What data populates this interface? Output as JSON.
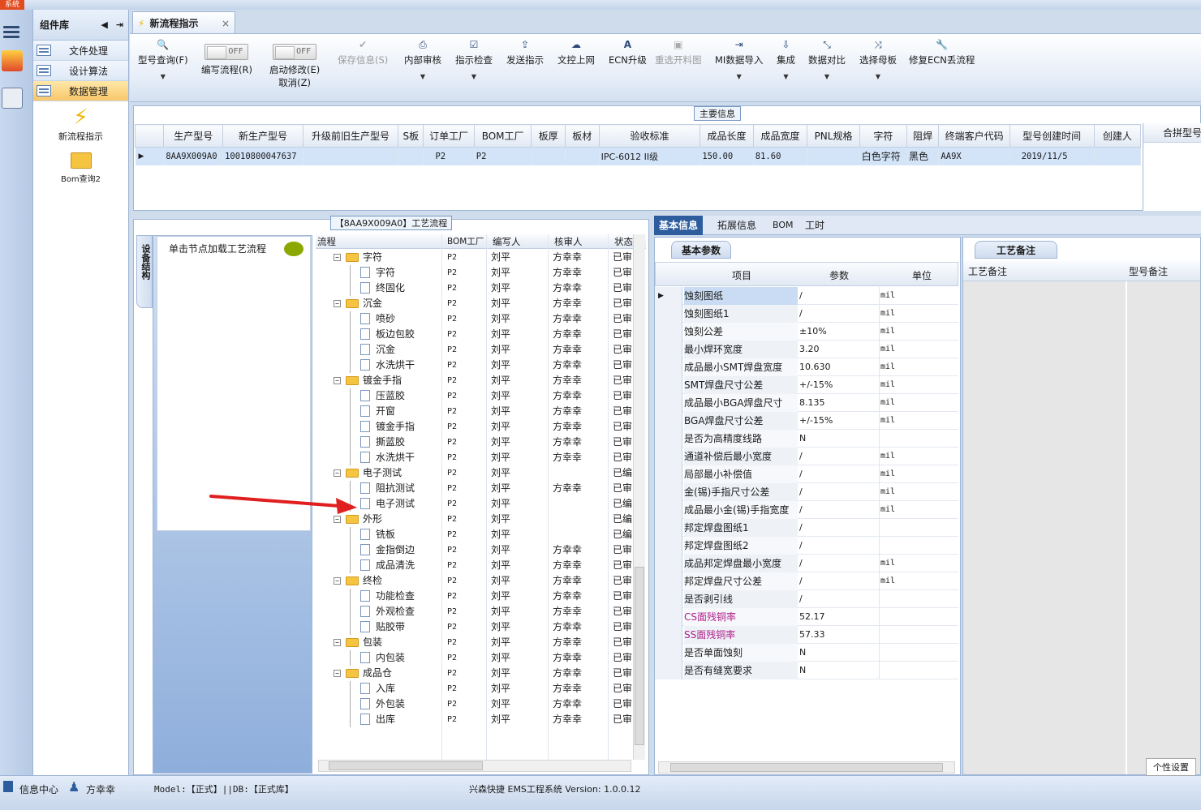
{
  "window": {
    "title": "系统"
  },
  "left_panel": {
    "title": "组件库",
    "items": [
      {
        "label": "文件处理"
      },
      {
        "label": "设计算法"
      },
      {
        "label": "数据管理"
      }
    ],
    "big_items": [
      {
        "label": "新流程指示",
        "icon": "lightning-icon"
      },
      {
        "label": "Bom查询2",
        "icon": "folder-open-icon"
      }
    ]
  },
  "doc_tab": {
    "title": "新流程指示"
  },
  "toolbar": {
    "items": [
      {
        "label": "型号查询(F)",
        "icon": "search-icon"
      },
      {
        "label": "编写流程(R)",
        "toggle": "OFF"
      },
      {
        "label": "启动修改(E)",
        "sub": "取消(Z)",
        "toggle": "OFF"
      },
      {
        "label": "保存信息(S)",
        "icon": "check-icon",
        "disabled": true
      },
      {
        "label": "内部审核",
        "icon": "printer-icon"
      },
      {
        "label": "指示检查",
        "icon": "checkbox-icon"
      },
      {
        "label": "发送指示",
        "icon": "upload-icon"
      },
      {
        "label": "文控上网",
        "icon": "cloud-upload-icon"
      },
      {
        "label": "ECN升级",
        "icon": "font-icon"
      },
      {
        "label": "重选开料图",
        "icon": "image-icon",
        "disabled": true
      },
      {
        "label": "MI数据导入",
        "icon": "import-icon"
      },
      {
        "label": "集成",
        "icon": "download-icon"
      },
      {
        "label": "数据对比",
        "icon": "compress-icon"
      },
      {
        "label": "选择母板",
        "icon": "shuffle-icon"
      },
      {
        "label": "修复ECN丢流程",
        "icon": "wrench-icon"
      }
    ]
  },
  "main_info": {
    "title": "主要信息",
    "columns": [
      "生产型号",
      "新生产型号",
      "升级前旧生产型号",
      "S板",
      "订单工厂",
      "BOM工厂",
      "板厚",
      "板材",
      "验收标准",
      "成品长度",
      "成品宽度",
      "PNL规格",
      "字符",
      "阻焊",
      "终端客户代码",
      "型号创建时间",
      "创建人"
    ],
    "rows": [
      [
        "8AA9X009A0",
        "10010800047637",
        "",
        "",
        "P2",
        "P2",
        "",
        "",
        "IPC-6012 II级",
        "150.00",
        "81.60",
        "",
        "白色字符",
        "黑色",
        "AA9X",
        "2019/11/5",
        ""
      ]
    ],
    "right_header": "合拼型号"
  },
  "flow_panel": {
    "title": "【8AA9X009A0】工艺流程",
    "side_tab": "设备结构",
    "hint": "单击节点加载工艺流程",
    "columns": [
      "流程",
      "BOM工厂",
      "编写人",
      "核审人",
      "状态"
    ],
    "rows": [
      {
        "level": 0,
        "name": "字符",
        "bom": "P2",
        "writer": "刘平",
        "reviewer": "方幸幸",
        "status": "已审"
      },
      {
        "level": 1,
        "name": "字符",
        "bom": "P2",
        "writer": "刘平",
        "reviewer": "方幸幸",
        "status": "已审"
      },
      {
        "level": 1,
        "name": "终固化",
        "bom": "P2",
        "writer": "刘平",
        "reviewer": "方幸幸",
        "status": "已审"
      },
      {
        "level": 0,
        "name": "沉金",
        "bom": "P2",
        "writer": "刘平",
        "reviewer": "方幸幸",
        "status": "已审"
      },
      {
        "level": 1,
        "name": "喷砂",
        "bom": "P2",
        "writer": "刘平",
        "reviewer": "方幸幸",
        "status": "已审"
      },
      {
        "level": 1,
        "name": "板边包胶",
        "bom": "P2",
        "writer": "刘平",
        "reviewer": "方幸幸",
        "status": "已审"
      },
      {
        "level": 1,
        "name": "沉金",
        "bom": "P2",
        "writer": "刘平",
        "reviewer": "方幸幸",
        "status": "已审"
      },
      {
        "level": 1,
        "name": "水洗烘干",
        "bom": "P2",
        "writer": "刘平",
        "reviewer": "方幸幸",
        "status": "已审"
      },
      {
        "level": 0,
        "name": "镀金手指",
        "bom": "P2",
        "writer": "刘平",
        "reviewer": "方幸幸",
        "status": "已审"
      },
      {
        "level": 1,
        "name": "压蓝胶",
        "bom": "P2",
        "writer": "刘平",
        "reviewer": "方幸幸",
        "status": "已审"
      },
      {
        "level": 1,
        "name": "开窗",
        "bom": "P2",
        "writer": "刘平",
        "reviewer": "方幸幸",
        "status": "已审"
      },
      {
        "level": 1,
        "name": "镀金手指",
        "bom": "P2",
        "writer": "刘平",
        "reviewer": "方幸幸",
        "status": "已审"
      },
      {
        "level": 1,
        "name": "撕蓝胶",
        "bom": "P2",
        "writer": "刘平",
        "reviewer": "方幸幸",
        "status": "已审"
      },
      {
        "level": 1,
        "name": "水洗烘干",
        "bom": "P2",
        "writer": "刘平",
        "reviewer": "方幸幸",
        "status": "已审"
      },
      {
        "level": 0,
        "name": "电子测试",
        "bom": "P2",
        "writer": "刘平",
        "reviewer": "",
        "status": "已编"
      },
      {
        "level": 1,
        "name": "阻抗测试",
        "bom": "P2",
        "writer": "刘平",
        "reviewer": "方幸幸",
        "status": "已审"
      },
      {
        "level": 1,
        "name": "电子测试",
        "bom": "P2",
        "writer": "刘平",
        "reviewer": "",
        "status": "已编"
      },
      {
        "level": 0,
        "name": "外形",
        "bom": "P2",
        "writer": "刘平",
        "reviewer": "",
        "status": "已编"
      },
      {
        "level": 1,
        "name": "铣板",
        "bom": "P2",
        "writer": "刘平",
        "reviewer": "",
        "status": "已编"
      },
      {
        "level": 1,
        "name": "金指倒边",
        "bom": "P2",
        "writer": "刘平",
        "reviewer": "方幸幸",
        "status": "已审"
      },
      {
        "level": 1,
        "name": "成品清洗",
        "bom": "P2",
        "writer": "刘平",
        "reviewer": "方幸幸",
        "status": "已审"
      },
      {
        "level": 0,
        "name": "终检",
        "bom": "P2",
        "writer": "刘平",
        "reviewer": "方幸幸",
        "status": "已审"
      },
      {
        "level": 1,
        "name": "功能检查",
        "bom": "P2",
        "writer": "刘平",
        "reviewer": "方幸幸",
        "status": "已审"
      },
      {
        "level": 1,
        "name": "外观检查",
        "bom": "P2",
        "writer": "刘平",
        "reviewer": "方幸幸",
        "status": "已审"
      },
      {
        "level": 1,
        "name": "贴胶带",
        "bom": "P2",
        "writer": "刘平",
        "reviewer": "方幸幸",
        "status": "已审"
      },
      {
        "level": 0,
        "name": "包装",
        "bom": "P2",
        "writer": "刘平",
        "reviewer": "方幸幸",
        "status": "已审"
      },
      {
        "level": 1,
        "name": "内包装",
        "bom": "P2",
        "writer": "刘平",
        "reviewer": "方幸幸",
        "status": "已审"
      },
      {
        "level": 0,
        "name": "成品仓",
        "bom": "P2",
        "writer": "刘平",
        "reviewer": "方幸幸",
        "status": "已审"
      },
      {
        "level": 1,
        "name": "入库",
        "bom": "P2",
        "writer": "刘平",
        "reviewer": "方幸幸",
        "status": "已审"
      },
      {
        "level": 1,
        "name": "外包装",
        "bom": "P2",
        "writer": "刘平",
        "reviewer": "方幸幸",
        "status": "已审"
      },
      {
        "level": 1,
        "name": "出库",
        "bom": "P2",
        "writer": "刘平",
        "reviewer": "方幸幸",
        "status": "已审"
      }
    ]
  },
  "right_tabs": [
    "基本信息",
    "拓展信息",
    "BOM",
    "工时"
  ],
  "basic_params": {
    "title": "基本参数",
    "columns": [
      "项目",
      "参数",
      "单位"
    ],
    "rows": [
      {
        "item": "蚀刻图纸",
        "value": "/",
        "unit": "mil"
      },
      {
        "item": "蚀刻图纸1",
        "value": "/",
        "unit": "mil"
      },
      {
        "item": "蚀刻公差",
        "value": "±10%",
        "unit": "mil"
      },
      {
        "item": "最小焊环宽度",
        "value": "3.20",
        "unit": "mil"
      },
      {
        "item": "成品最小SMT焊盘宽度",
        "value": "10.630",
        "unit": "mil"
      },
      {
        "item": "SMT焊盘尺寸公差",
        "value": "+/-15%",
        "unit": "mil"
      },
      {
        "item": "成品最小BGA焊盘尺寸",
        "value": "8.135",
        "unit": "mil"
      },
      {
        "item": "BGA焊盘尺寸公差",
        "value": "+/-15%",
        "unit": "mil"
      },
      {
        "item": "是否为高精度线路",
        "value": "N",
        "unit": ""
      },
      {
        "item": "通道补偿后最小宽度",
        "value": "/",
        "unit": "mil"
      },
      {
        "item": "局部最小补偿值",
        "value": "/",
        "unit": "mil"
      },
      {
        "item": "金(锡)手指尺寸公差",
        "value": "/",
        "unit": "mil"
      },
      {
        "item": "成品最小金(锡)手指宽度",
        "value": "/",
        "unit": "mil"
      },
      {
        "item": "邦定焊盘图纸1",
        "value": "/",
        "unit": ""
      },
      {
        "item": "邦定焊盘图纸2",
        "value": "/",
        "unit": ""
      },
      {
        "item": "成品邦定焊盘最小宽度",
        "value": "/",
        "unit": "mil"
      },
      {
        "item": "邦定焊盘尺寸公差",
        "value": "/",
        "unit": "mil"
      },
      {
        "item": "是否剥引线",
        "value": "/",
        "unit": ""
      },
      {
        "item": "CS面残铜率",
        "value": "52.17",
        "unit": "",
        "highlight": true
      },
      {
        "item": "SS面残铜率",
        "value": "57.33",
        "unit": "",
        "highlight": true
      },
      {
        "item": "是否单面蚀刻",
        "value": "N",
        "unit": ""
      },
      {
        "item": "是否有缝宽要求",
        "value": "N",
        "unit": ""
      }
    ]
  },
  "notes": {
    "title": "工艺备注",
    "col1": "工艺备注",
    "col2": "型号备注"
  },
  "statusbar": {
    "info_center": "信息中心",
    "user": "方幸幸",
    "model": "Model:【正式】||DB:【正式库】",
    "app": "兴森快捷 EMS工程系统 Version: 1.0.0.12",
    "tooltip": "个性设置"
  },
  "colors": {
    "accent": "#2e5d9e",
    "highlight_text": "#b0208c",
    "selected_row": "#d3e4f8",
    "arrow": "#e02020"
  }
}
